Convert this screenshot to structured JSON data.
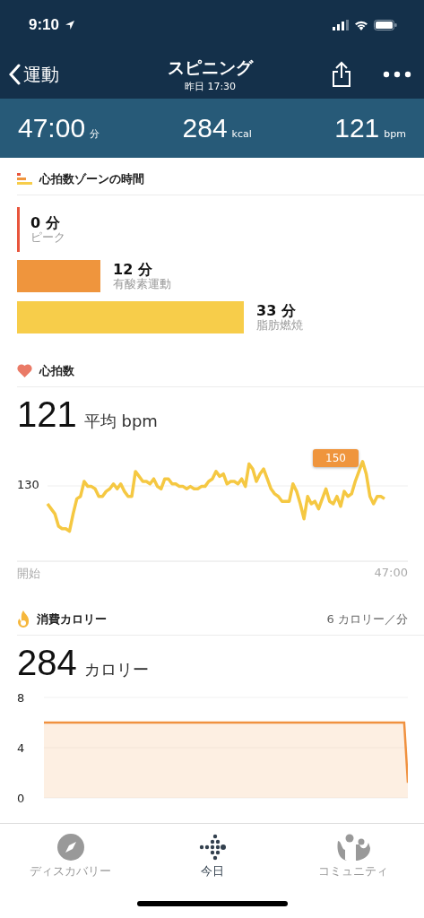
{
  "status_bar": {
    "time": "9:10"
  },
  "nav": {
    "back": "運動",
    "title": "スピニング",
    "subtitle": "昨日 17:30"
  },
  "summary": [
    {
      "value": "47:00",
      "unit": "分"
    },
    {
      "value": "284",
      "unit": "kcal"
    },
    {
      "value": "121",
      "unit": "bpm"
    }
  ],
  "zones": {
    "title": "心拍数ゾーンの時間",
    "items": [
      {
        "minutes": "0 分",
        "name": "ピーク",
        "color": "#e8553c"
      },
      {
        "minutes": "12 分",
        "name": "有酸素運動",
        "color": "#ef953d"
      },
      {
        "minutes": "33 分",
        "name": "脂肪燃焼",
        "color": "#f7cd4a"
      }
    ]
  },
  "heart_rate": {
    "title": "心拍数",
    "value": "121",
    "unit": "平均 bpm",
    "tick": "130",
    "peak_badge": "150",
    "x_start": "開始",
    "x_end": "47:00"
  },
  "calories": {
    "title": "消費カロリー",
    "rate": "6 カロリー／分",
    "value": "284",
    "unit": "カロリー",
    "chart_data": {
      "type": "area",
      "series": [
        {
          "color": "#f0913f",
          "values": [
            6,
            6,
            6,
            6,
            6,
            6,
            6,
            6,
            6,
            6,
            6,
            6,
            6,
            6,
            6,
            6,
            6,
            6,
            6,
            6,
            6,
            6,
            6,
            6,
            6,
            6,
            6,
            6,
            6,
            6,
            6,
            6,
            6,
            6,
            6,
            6,
            6,
            6,
            6,
            6,
            6,
            6,
            6,
            6,
            6,
            6,
            6,
            6,
            6,
            6,
            6,
            6,
            6,
            6,
            6,
            6,
            6,
            6,
            6,
            6,
            6,
            6,
            6,
            6,
            6,
            6,
            6,
            6,
            6,
            6,
            6,
            6,
            6,
            6,
            6,
            6,
            6,
            6,
            6,
            6,
            6,
            6,
            6,
            6,
            6,
            6,
            6,
            6,
            6,
            6,
            6,
            6,
            6,
            6,
            6,
            6,
            6,
            6,
            6,
            1.2
          ]
        }
      ],
      "ylim": [
        0,
        8
      ],
      "yticks": [
        0,
        4,
        8
      ]
    }
  },
  "tabs": [
    {
      "label": "ディスカバリー",
      "selected": false
    },
    {
      "label": "今日",
      "selected": true
    },
    {
      "label": "コミュニティ",
      "selected": false
    }
  ]
}
